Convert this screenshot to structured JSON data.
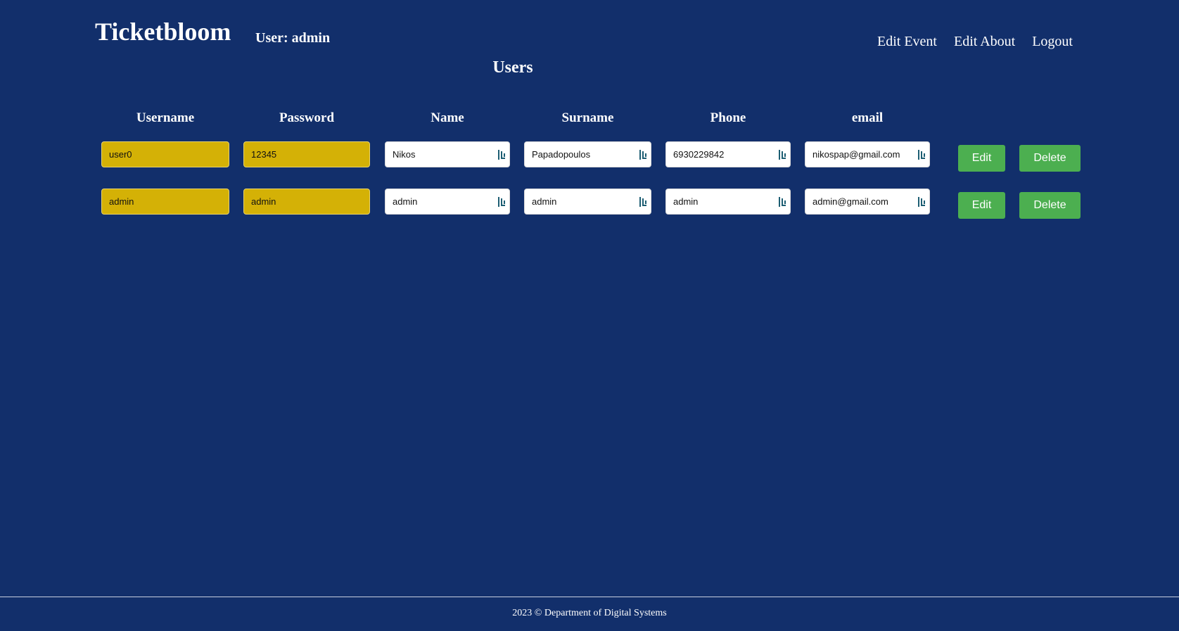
{
  "header": {
    "brand": "Ticketbloom",
    "user_label": "User: admin",
    "nav": [
      "Edit Event",
      "Edit About",
      "Logout"
    ]
  },
  "page": {
    "title": "Users"
  },
  "table": {
    "columns": [
      "Username",
      "Password",
      "Name",
      "Surname",
      "Phone",
      "email"
    ],
    "rows": [
      {
        "username": "user0",
        "password": "12345",
        "name": "Nikos",
        "surname": "Papadopoulos",
        "phone": "6930229842",
        "email": "nikospap@gmail.com",
        "edit_label": "Edit",
        "delete_label": "Delete"
      },
      {
        "username": "admin",
        "password": "admin",
        "name": "admin",
        "surname": "admin",
        "phone": "admin",
        "email": "admin@gmail.com",
        "edit_label": "Edit",
        "delete_label": "Delete"
      }
    ]
  },
  "footer": {
    "text": "2023 © Department of Digital Systems"
  },
  "colors": {
    "background": "#122f6b",
    "readonly_field": "#d4b106",
    "button": "#4caf50"
  },
  "icons": {
    "field_icon": "password-manager-key-icon"
  }
}
